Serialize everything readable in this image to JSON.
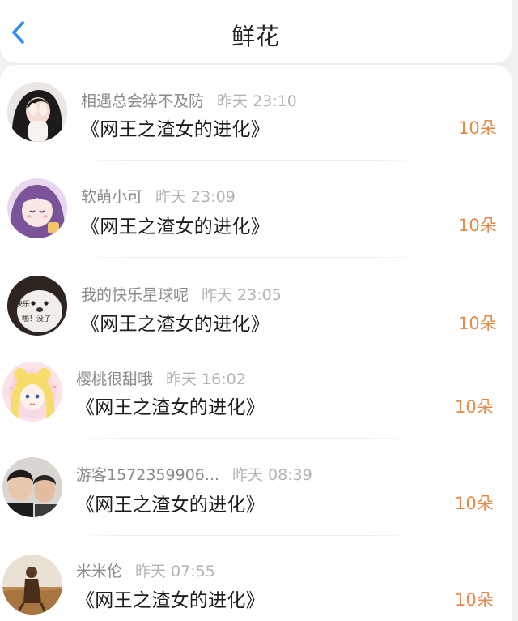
{
  "header": {
    "title": "鲜花"
  },
  "icons": {
    "back": "chevron-left-icon"
  },
  "colors": {
    "accent": "#e58a48",
    "back": "#2f8cf6"
  },
  "items": [
    {
      "name": "相遇总会猝不及防",
      "time": "昨天 23:10",
      "book": "《网王之渣女的进化》",
      "count": "10朵"
    },
    {
      "name": "软萌小可",
      "time": "昨天 23:09",
      "book": "《网王之渣女的进化》",
      "count": "10朵"
    },
    {
      "name": "我的快乐星球呢",
      "time": "昨天 23:05",
      "book": "《网王之渣女的进化》",
      "count": "10朵",
      "avatar_text": [
        "快乐",
        "啪！没了"
      ]
    },
    {
      "name": "樱桃很甜哦",
      "time": "昨天 16:02",
      "book": "《网王之渣女的进化》",
      "count": "10朵"
    },
    {
      "name": "游客1572359906...",
      "time": "昨天 08:39",
      "book": "《网王之渣女的进化》",
      "count": "10朵"
    },
    {
      "name": "米米伦",
      "time": "昨天 07:55",
      "book": "《网王之渣女的进化》",
      "count": "10朵"
    }
  ]
}
